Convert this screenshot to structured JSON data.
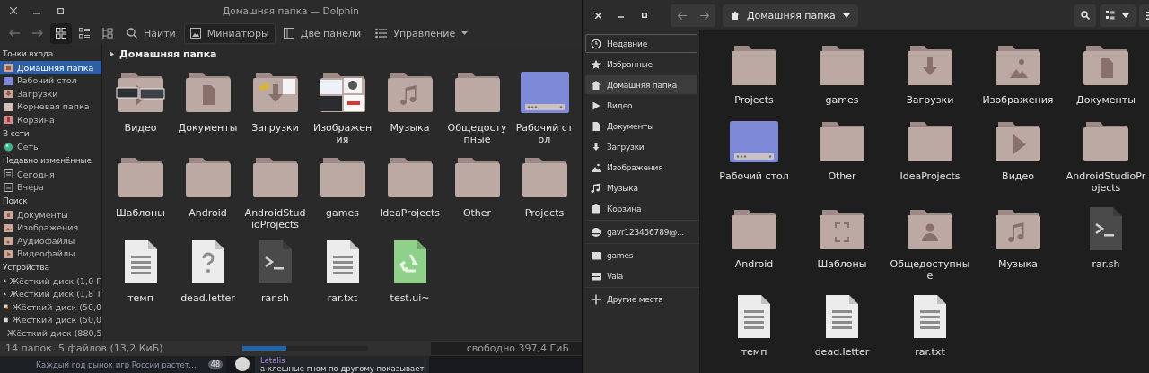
{
  "dolphin": {
    "title": "Домашняя папка — Dolphin",
    "toolbar": [
      {
        "kind": "back",
        "disabled": true
      },
      {
        "kind": "forward",
        "disabled": true
      },
      {
        "kind": "view-icons",
        "selected": true
      },
      {
        "kind": "view-compact",
        "selected": false
      },
      {
        "kind": "view-details",
        "selected": false
      },
      {
        "kind": "search",
        "label": "Найти"
      },
      {
        "kind": "preview",
        "label": "Миниатюры",
        "checked": true
      },
      {
        "kind": "split",
        "label": "Две панели"
      },
      {
        "kind": "menu",
        "label": "Управление"
      }
    ],
    "places": [
      {
        "heading": "Точки входа",
        "items": [
          {
            "label": "Домашняя папка",
            "kind": "home",
            "selected": true
          },
          {
            "label": "Рабочий стол",
            "kind": "desktop",
            "selected": false
          },
          {
            "label": "Загрузки",
            "kind": "download",
            "selected": false
          },
          {
            "label": "Корневая папка",
            "kind": "root",
            "selected": false
          },
          {
            "label": "Корзина",
            "kind": "trash",
            "selected": false
          }
        ]
      },
      {
        "heading": "В сети",
        "items": [
          {
            "label": "Сеть",
            "kind": "network",
            "selected": false
          }
        ]
      },
      {
        "heading": "Недавно изменённые",
        "items": [
          {
            "label": "Сегодня",
            "kind": "calendar",
            "selected": false
          },
          {
            "label": "Вчера",
            "kind": "calendar",
            "selected": false
          }
        ]
      },
      {
        "heading": "Поиск",
        "items": [
          {
            "label": "Документы",
            "kind": "documents",
            "selected": false
          },
          {
            "label": "Изображения",
            "kind": "pictures",
            "selected": false
          },
          {
            "label": "Аудиофайлы",
            "kind": "music",
            "selected": false
          },
          {
            "label": "Видеофайлы",
            "kind": "video",
            "selected": false
          }
        ]
      },
      {
        "heading": "Устройства",
        "items": [
          {
            "label": "Жёсткий диск (1,0 Г",
            "kind": "drive-warning",
            "selected": false
          },
          {
            "label": "Жёсткий диск (1,8 Т",
            "kind": "drive-warning",
            "selected": false
          },
          {
            "label": "Жёсткий диск (50,0",
            "kind": "drive-warning",
            "selected": false
          },
          {
            "label": "Жёсткий диск (50,0",
            "kind": "drive",
            "selected": false
          },
          {
            "label": "Жёсткий диск (880,5",
            "kind": "drive",
            "selected": false
          }
        ]
      }
    ],
    "breadcrumb": "Домашняя папка",
    "files": [
      {
        "name": "Видео",
        "kind": "video-thumbs"
      },
      {
        "name": "Документы",
        "kind": "documents"
      },
      {
        "name": "Загрузки",
        "kind": "download-thumbs"
      },
      {
        "name": "Изображения",
        "kind": "pictures-thumbs"
      },
      {
        "name": "Музыка",
        "kind": "music"
      },
      {
        "name": "Общедоступные",
        "kind": "folder"
      },
      {
        "name": "Рабочий стол",
        "kind": "desktop"
      },
      {
        "name": "Шаблоны",
        "kind": "folder"
      },
      {
        "name": "Android",
        "kind": "folder"
      },
      {
        "name": "AndroidStudioProjects",
        "kind": "folder"
      },
      {
        "name": "games",
        "kind": "folder"
      },
      {
        "name": "IdeaProjects",
        "kind": "folder"
      },
      {
        "name": "Other",
        "kind": "folder"
      },
      {
        "name": "Projects",
        "kind": "folder"
      },
      {
        "name": "темп",
        "kind": "text"
      },
      {
        "name": "dead.letter",
        "kind": "unknown"
      },
      {
        "name": "rar.sh",
        "kind": "script"
      },
      {
        "name": "rar.txt",
        "kind": "text"
      },
      {
        "name": "test.ui~",
        "kind": "recycle"
      }
    ],
    "status_bar": {
      "text": "14 папок. 5 файлов (13,2 КиБ)",
      "level": 0.35,
      "free": "свободно 397,4 ГиБ"
    }
  },
  "nautilus": {
    "path": "Домашняя папка",
    "places": [
      {
        "label": "Недавние",
        "kind": "recent",
        "selected": false,
        "focused": true
      },
      {
        "label": "Избранные",
        "kind": "star",
        "selected": false,
        "focused": false
      },
      {
        "label": "Домашняя папка",
        "kind": "home",
        "selected": true,
        "focused": false
      },
      {
        "label": "Видео",
        "kind": "video",
        "selected": false,
        "focused": false
      },
      {
        "label": "Документы",
        "kind": "documents",
        "selected": false,
        "focused": false
      },
      {
        "label": "Загрузки",
        "kind": "download",
        "selected": false,
        "focused": false
      },
      {
        "label": "Изображения",
        "kind": "pictures",
        "selected": false,
        "focused": false
      },
      {
        "label": "Музыка",
        "kind": "music",
        "selected": false,
        "focused": false
      },
      {
        "label": "Корзина",
        "kind": "trash",
        "selected": false,
        "focused": false
      },
      {
        "label": "gavr123456789@...",
        "kind": "network",
        "selected": false,
        "focused": false
      },
      {
        "label": "games",
        "kind": "drive",
        "selected": false,
        "focused": false
      },
      {
        "label": "Vala",
        "kind": "drive",
        "selected": false,
        "focused": false
      },
      {
        "label": "Другие места",
        "kind": "other",
        "selected": false,
        "focused": false
      }
    ],
    "files": [
      {
        "name": "Projects",
        "kind": "folder"
      },
      {
        "name": "games",
        "kind": "folder"
      },
      {
        "name": "Загрузки",
        "kind": "download"
      },
      {
        "name": "Изображения",
        "kind": "pictures"
      },
      {
        "name": "Документы",
        "kind": "documents"
      },
      {
        "name": "Рабочий стол",
        "kind": "desktop"
      },
      {
        "name": "Other",
        "kind": "folder"
      },
      {
        "name": "IdeaProjects",
        "kind": "folder"
      },
      {
        "name": "Видео",
        "kind": "video"
      },
      {
        "name": "AndroidStudioProjects",
        "kind": "folder"
      },
      {
        "name": "Android",
        "kind": "folder"
      },
      {
        "name": "Шаблоны",
        "kind": "templates"
      },
      {
        "name": "Общедоступные",
        "kind": "public"
      },
      {
        "name": "Музыка",
        "kind": "music"
      },
      {
        "name": "rar.sh",
        "kind": "script"
      },
      {
        "name": "темп",
        "kind": "text"
      },
      {
        "name": "dead.letter",
        "kind": "text"
      },
      {
        "name": "rar.txt",
        "kind": "text"
      }
    ]
  },
  "chat": {
    "preview": "Каждый год рынок игр России растет...",
    "badge": "48",
    "author": "Letalis",
    "message": "а клешные гном по другому показывает"
  }
}
